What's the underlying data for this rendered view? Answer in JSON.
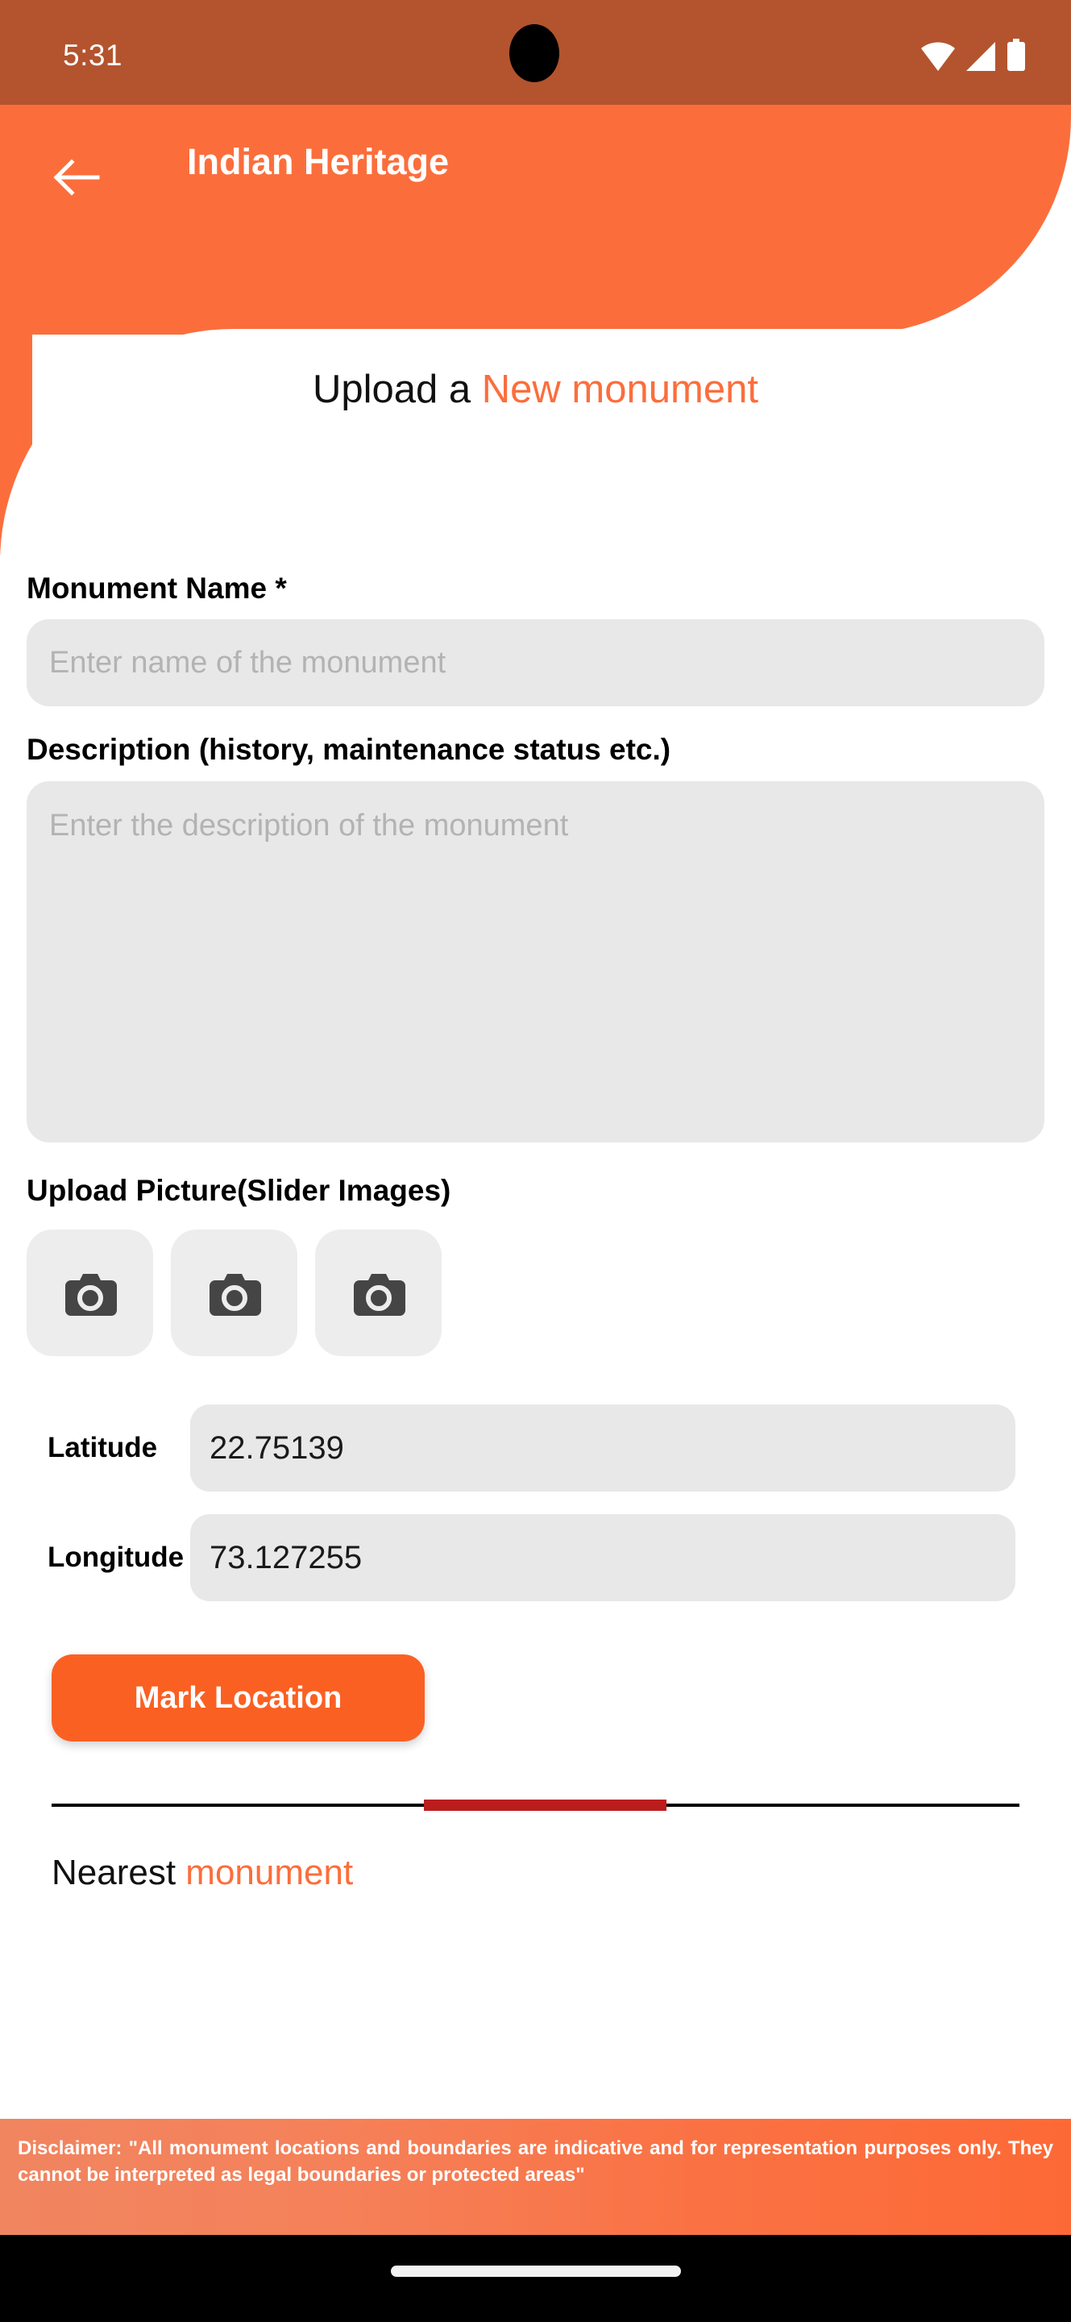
{
  "status_bar": {
    "time": "5:31",
    "icons": [
      "wifi-icon",
      "cellular-signal-icon",
      "battery-icon"
    ],
    "background_color": "#b3542e"
  },
  "header": {
    "title": "Indian Heritage",
    "back_icon": "arrow-left-icon",
    "background_color": "#fb6e3c"
  },
  "page_heading": {
    "prefix": "Upload a ",
    "accent": "New monument",
    "accent_color": "#fb6e3c"
  },
  "form": {
    "monument_name": {
      "label": "Monument Name *",
      "placeholder": "Enter name of the monument",
      "value": ""
    },
    "description": {
      "label": "Description (history, maintenance status etc.)",
      "placeholder": "Enter the description of the monument",
      "value": ""
    },
    "upload_picture": {
      "label": "Upload Picture(Slider Images)",
      "slots": [
        {
          "icon": "camera-icon"
        },
        {
          "icon": "camera-icon"
        },
        {
          "icon": "camera-icon"
        }
      ]
    },
    "latitude": {
      "label": "Latitude",
      "value": "22.75139"
    },
    "longitude": {
      "label": "Longitude",
      "value": "73.127255"
    },
    "mark_location_button": {
      "label": "Mark Location",
      "background_color": "#fb6023",
      "text_color": "#ffffff"
    }
  },
  "divider": {
    "line_color": "#000000",
    "progress_color": "#bb1d1d"
  },
  "nearest_section": {
    "prefix": "Nearest ",
    "accent": "monument",
    "accent_color": "#fb6e3c"
  },
  "disclaimer": {
    "text": "Disclaimer: \"All monument locations and boundaries are indicative and for representation purposes only. They cannot be interpreted as legal boundaries or protected areas\"",
    "gradient_from": "#f08560",
    "gradient_to": "#fd6936",
    "text_color": "#ffffff"
  },
  "nav_bar": {
    "home_indicator": "home-indicator",
    "background_color": "#000000"
  }
}
